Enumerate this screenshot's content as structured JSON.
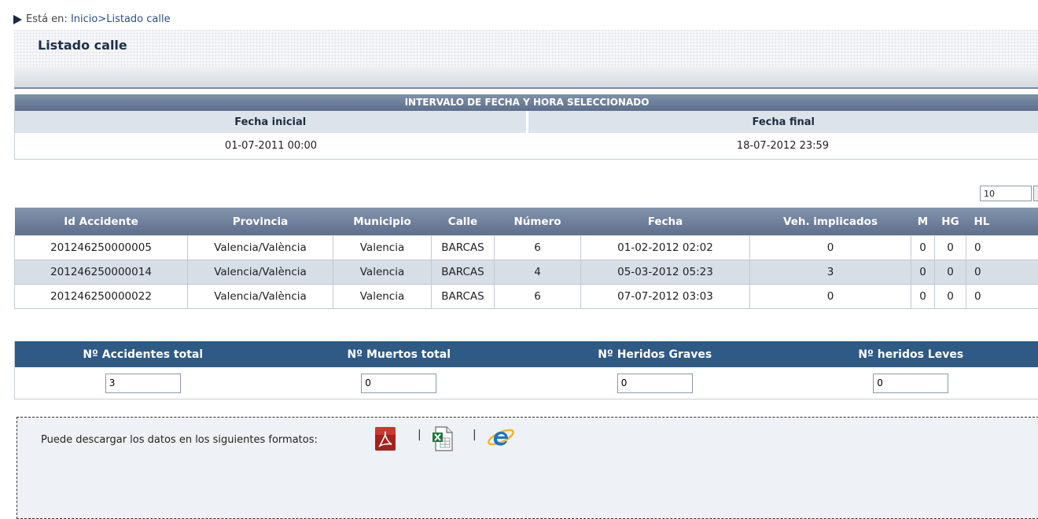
{
  "breadcrumb": {
    "prefix": "Está en:",
    "path": "Inicio>Listado calle"
  },
  "page_title": "Listado calle",
  "range": {
    "header": "INTERVALO DE FECHA Y HORA SELECCIONADO",
    "start_label": "Fecha inicial",
    "end_label": "Fecha final",
    "start_value": "01-07-2011 00:00",
    "end_value": "18-07-2012 23:59"
  },
  "page_size": "10",
  "table": {
    "columns": [
      "Id Accidente",
      "Provincia",
      "Municipio",
      "Calle",
      "Número",
      "Fecha",
      "Veh. implicados",
      "M",
      "HG",
      "HL"
    ],
    "rows": [
      [
        "201246250000005",
        "Valencia/València",
        "Valencia",
        "BARCAS",
        "6",
        "01-02-2012 02:02",
        "0",
        "0",
        "0",
        "0"
      ],
      [
        "201246250000014",
        "Valencia/València",
        "Valencia",
        "BARCAS",
        "4",
        "05-03-2012 05:23",
        "3",
        "0",
        "0",
        "0"
      ],
      [
        "201246250000022",
        "Valencia/València",
        "Valencia",
        "BARCAS",
        "6",
        "07-07-2012 03:03",
        "0",
        "0",
        "0",
        "0"
      ]
    ]
  },
  "totals": {
    "accidents_label": "Nº Accidentes total",
    "deaths_label": "Nº Muertos total",
    "serious_label": "Nº Heridos Graves",
    "light_label": "Nº heridos Leves",
    "accidents_value": "3",
    "deaths_value": "0",
    "serious_value": "0",
    "light_value": "0"
  },
  "download": {
    "label": "Puede descargar los datos en los siguientes formatos:",
    "separator": "|"
  },
  "icons": [
    "pdf-icon",
    "excel-icon",
    "internet-explorer-icon"
  ],
  "colors": {
    "header_blue": "#5d6f8c",
    "totals_header": "#2e5a85",
    "alt_row": "#d7dee6"
  }
}
